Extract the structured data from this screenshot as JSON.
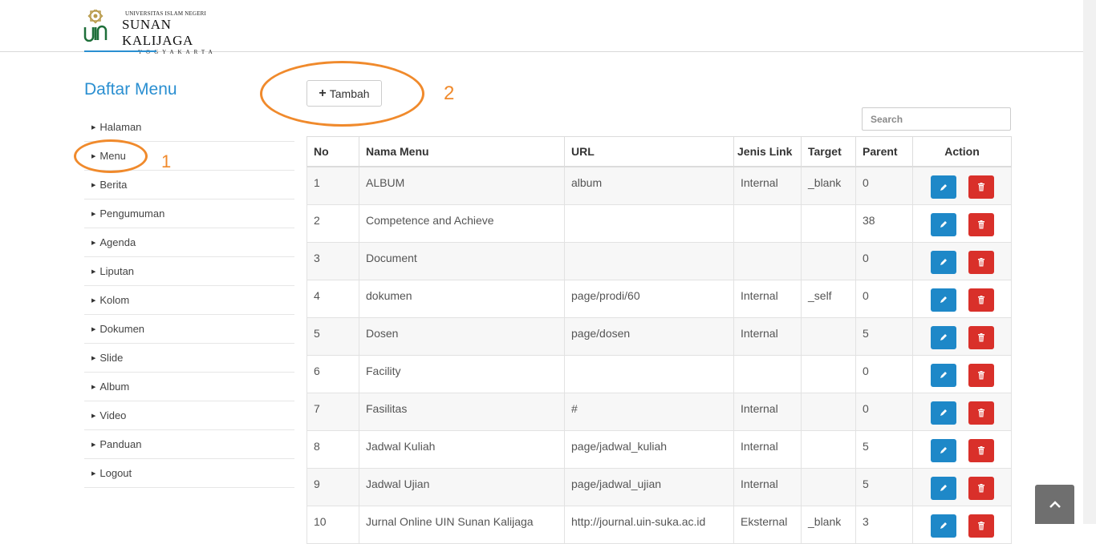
{
  "logo": {
    "line1": "UNIVERSITAS ISLAM NEGERI",
    "line2": "SUNAN KALIJAGA",
    "line3": "YOGYAKARTA",
    "brand_color": "#1e6f3a"
  },
  "sidebar": {
    "title": "Daftar Menu",
    "items": [
      {
        "label": "Halaman"
      },
      {
        "label": "Menu"
      },
      {
        "label": "Berita"
      },
      {
        "label": "Pengumuman"
      },
      {
        "label": "Agenda"
      },
      {
        "label": "Liputan"
      },
      {
        "label": "Kolom"
      },
      {
        "label": "Dokumen"
      },
      {
        "label": "Slide"
      },
      {
        "label": "Album"
      },
      {
        "label": "Video"
      },
      {
        "label": "Panduan"
      },
      {
        "label": "Logout"
      }
    ]
  },
  "annotations": {
    "one": "1",
    "two": "2",
    "color": "#f08a2c"
  },
  "toolbar": {
    "add_label": "Tambah"
  },
  "search": {
    "placeholder": "Search"
  },
  "table": {
    "headers": {
      "no": "No",
      "nama": "Nama Menu",
      "url": "URL",
      "jenis": "Jenis Link",
      "target": "Target",
      "parent": "Parent",
      "action": "Action"
    },
    "rows": [
      {
        "no": "1",
        "nama": "ALBUM",
        "url": "album",
        "jenis": "Internal",
        "target": "_blank",
        "parent": "0"
      },
      {
        "no": "2",
        "nama": "Competence and Achieve",
        "url": "",
        "jenis": "",
        "target": "",
        "parent": "38"
      },
      {
        "no": "3",
        "nama": "Document",
        "url": "",
        "jenis": "",
        "target": "",
        "parent": "0"
      },
      {
        "no": "4",
        "nama": "dokumen",
        "url": "page/prodi/60",
        "jenis": "Internal",
        "target": "_self",
        "parent": "0"
      },
      {
        "no": "5",
        "nama": "Dosen",
        "url": "page/dosen",
        "jenis": "Internal",
        "target": "",
        "parent": "5"
      },
      {
        "no": "6",
        "nama": "Facility",
        "url": "",
        "jenis": "",
        "target": "",
        "parent": "0"
      },
      {
        "no": "7",
        "nama": "Fasilitas",
        "url": "#",
        "jenis": "Internal",
        "target": "",
        "parent": "0"
      },
      {
        "no": "8",
        "nama": "Jadwal Kuliah",
        "url": "page/jadwal_kuliah",
        "jenis": "Internal",
        "target": "",
        "parent": "5"
      },
      {
        "no": "9",
        "nama": "Jadwal Ujian",
        "url": "page/jadwal_ujian",
        "jenis": "Internal",
        "target": "",
        "parent": "5"
      },
      {
        "no": "10",
        "nama": "Jurnal Online UIN Sunan Kalijaga",
        "url": "http://journal.uin-suka.ac.id",
        "jenis": "Eksternal",
        "target": "_blank",
        "parent": "3"
      }
    ]
  },
  "colors": {
    "accent": "#2a8fd1",
    "edit": "#1e88c8",
    "delete": "#d9302a"
  }
}
